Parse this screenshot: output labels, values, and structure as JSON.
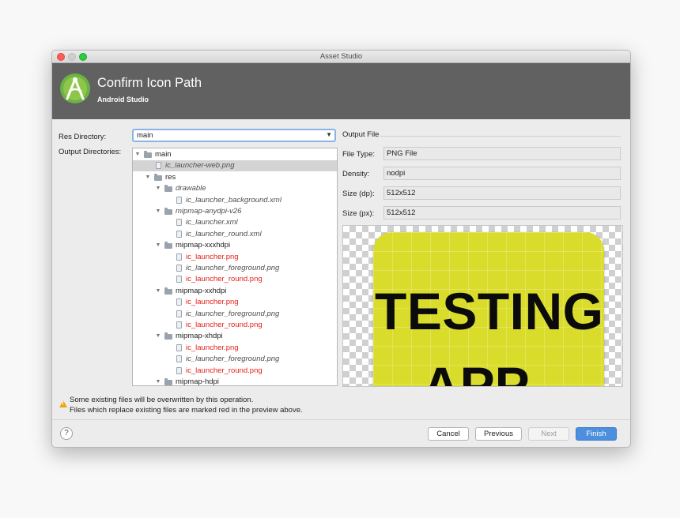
{
  "window": {
    "title": "Asset Studio"
  },
  "header": {
    "title": "Confirm Icon Path",
    "subtitle": "Android Studio"
  },
  "form": {
    "res_directory_label": "Res Directory:",
    "res_directory_value": "main",
    "output_directories_label": "Output Directories:"
  },
  "tree": {
    "rows": [
      {
        "label": "main",
        "kind": "folder",
        "expanded": true,
        "style": "normal"
      },
      {
        "label": "ic_launcher-web.png",
        "kind": "file",
        "style": "italic",
        "selected": true
      },
      {
        "label": "res",
        "kind": "folder",
        "expanded": true,
        "style": "normal"
      },
      {
        "label": "drawable",
        "kind": "folder",
        "expanded": true,
        "style": "italic"
      },
      {
        "label": "ic_launcher_background.xml",
        "kind": "file",
        "style": "italic"
      },
      {
        "label": "mipmap-anydpi-v26",
        "kind": "folder",
        "expanded": true,
        "style": "italic"
      },
      {
        "label": "ic_launcher.xml",
        "kind": "file",
        "style": "italic"
      },
      {
        "label": "ic_launcher_round.xml",
        "kind": "file",
        "style": "italic"
      },
      {
        "label": "mipmap-xxxhdpi",
        "kind": "folder",
        "expanded": true,
        "style": "normal"
      },
      {
        "label": "ic_launcher.png",
        "kind": "file",
        "style": "red"
      },
      {
        "label": "ic_launcher_foreground.png",
        "kind": "file",
        "style": "italic"
      },
      {
        "label": "ic_launcher_round.png",
        "kind": "file",
        "style": "red"
      },
      {
        "label": "mipmap-xxhdpi",
        "kind": "folder",
        "expanded": true,
        "style": "normal"
      },
      {
        "label": "ic_launcher.png",
        "kind": "file",
        "style": "red"
      },
      {
        "label": "ic_launcher_foreground.png",
        "kind": "file",
        "style": "italic"
      },
      {
        "label": "ic_launcher_round.png",
        "kind": "file",
        "style": "red"
      },
      {
        "label": "mipmap-xhdpi",
        "kind": "folder",
        "expanded": true,
        "style": "normal"
      },
      {
        "label": "ic_launcher.png",
        "kind": "file",
        "style": "red"
      },
      {
        "label": "ic_launcher_foreground.png",
        "kind": "file",
        "style": "italic"
      },
      {
        "label": "ic_launcher_round.png",
        "kind": "file",
        "style": "red"
      },
      {
        "label": "mipmap-hdpi",
        "kind": "folder",
        "expanded": true,
        "style": "normal"
      }
    ]
  },
  "output_file": {
    "section_label": "Output File",
    "file_type_label": "File Type:",
    "file_type_value": "PNG File",
    "density_label": "Density:",
    "density_value": "nodpi",
    "size_dp_label": "Size (dp):",
    "size_dp_value": "512x512",
    "size_px_label": "Size (px):",
    "size_px_value": "512x512"
  },
  "preview": {
    "line1": "TESTING",
    "line2": "APP",
    "tile_color": "#dadc2c"
  },
  "warning": {
    "icon": "warning-triangle-icon",
    "line1": "Some existing files will be overwritten by this operation.",
    "line2": "Files which replace existing files are marked red in the preview above."
  },
  "buttons": {
    "help": "?",
    "cancel": "Cancel",
    "previous": "Previous",
    "next": "Next",
    "finish": "Finish"
  },
  "colors": {
    "accent": "#4c8fde",
    "header_bg": "#616161",
    "overwrite_red": "#e0201b"
  }
}
